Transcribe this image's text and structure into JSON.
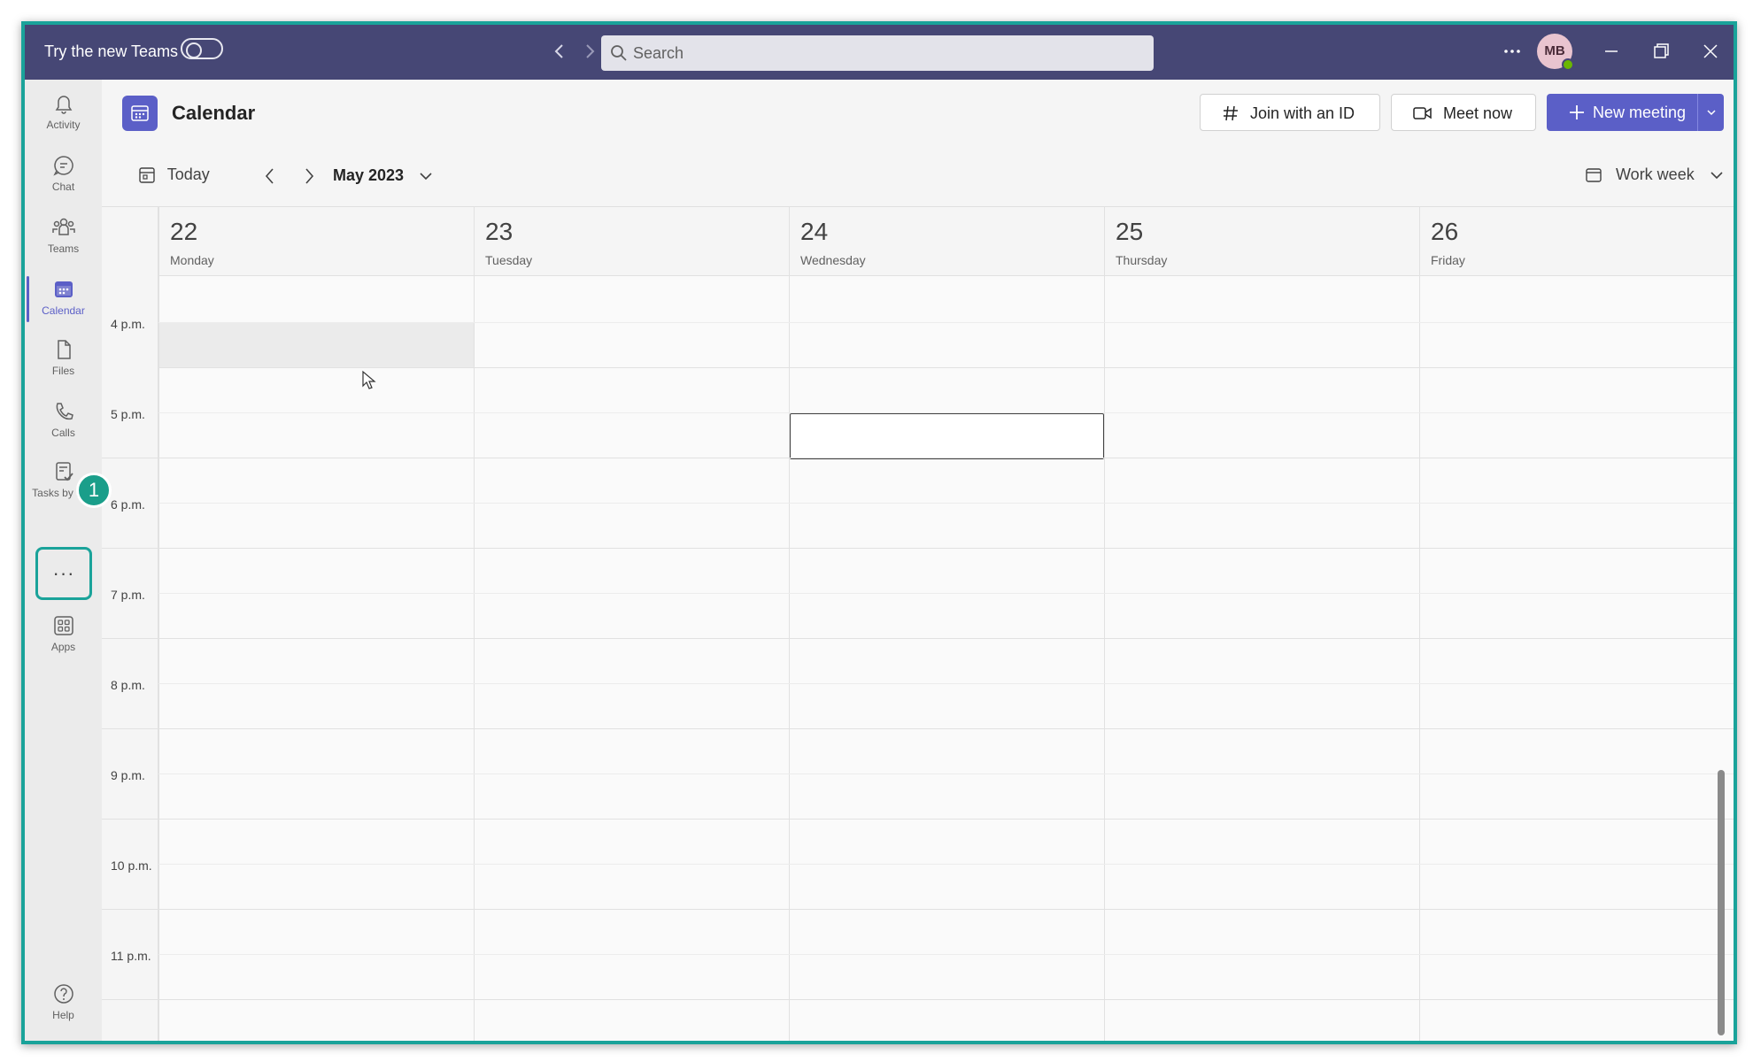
{
  "titlebar": {
    "try_label": "Try the new Teams",
    "search_placeholder": "Search",
    "avatar_initials": "MB"
  },
  "rail": {
    "items": [
      {
        "label": "Activity"
      },
      {
        "label": "Chat"
      },
      {
        "label": "Teams"
      },
      {
        "label": "Calendar"
      },
      {
        "label": "Files"
      },
      {
        "label": "Calls"
      },
      {
        "label": "Tasks by Pl..."
      }
    ],
    "more_label": "···",
    "apps_label": "Apps",
    "help_label": "Help",
    "step_badge": "1"
  },
  "header": {
    "title": "Calendar",
    "join_label": "Join with an ID",
    "meet_label": "Meet now",
    "new_meeting_label": "New meeting"
  },
  "toolbar": {
    "today_label": "Today",
    "month_label": "May 2023",
    "view_label": "Work week"
  },
  "days": [
    {
      "num": "22",
      "name": "Monday"
    },
    {
      "num": "23",
      "name": "Tuesday"
    },
    {
      "num": "24",
      "name": "Wednesday"
    },
    {
      "num": "25",
      "name": "Thursday"
    },
    {
      "num": "26",
      "name": "Friday"
    }
  ],
  "times": [
    "4 p.m.",
    "5 p.m.",
    "6 p.m.",
    "7 p.m.",
    "8 p.m.",
    "9 p.m.",
    "10 p.m.",
    "11 p.m."
  ],
  "colors": {
    "accent": "#5b5fc7",
    "titlebar": "#464775",
    "highlight": "#1aa39a"
  }
}
